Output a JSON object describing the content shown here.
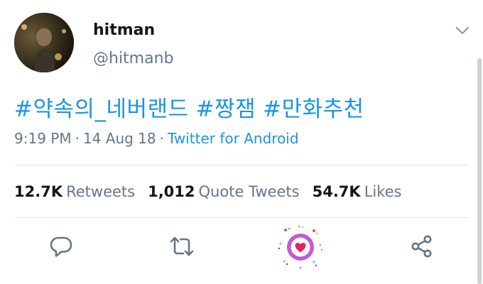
{
  "tweet": {
    "display_name": "hitman",
    "handle": "@hitmanb",
    "hashtags": [
      "#약속의_네버랜드",
      "#짱잼",
      "#만화추천"
    ],
    "time": "9:19 PM",
    "date": "14 Aug 18",
    "source": "Twitter for Android",
    "separator": "·"
  },
  "stats": {
    "retweets_count": "12.7K",
    "retweets_label": "Retweets",
    "quotes_count": "1,012",
    "quotes_label": "Quote Tweets",
    "likes_count": "54.7K",
    "likes_label": "Likes"
  },
  "colors": {
    "link": "#1b95e0",
    "secondary_text": "#657786",
    "like_circle": "#c05ad8",
    "like_heart": "#e0245e"
  },
  "icons": {
    "menu": "chevron-down-icon",
    "reply": "reply-icon",
    "retweet": "retweet-icon",
    "like": "heart-icon",
    "share": "share-icon"
  }
}
